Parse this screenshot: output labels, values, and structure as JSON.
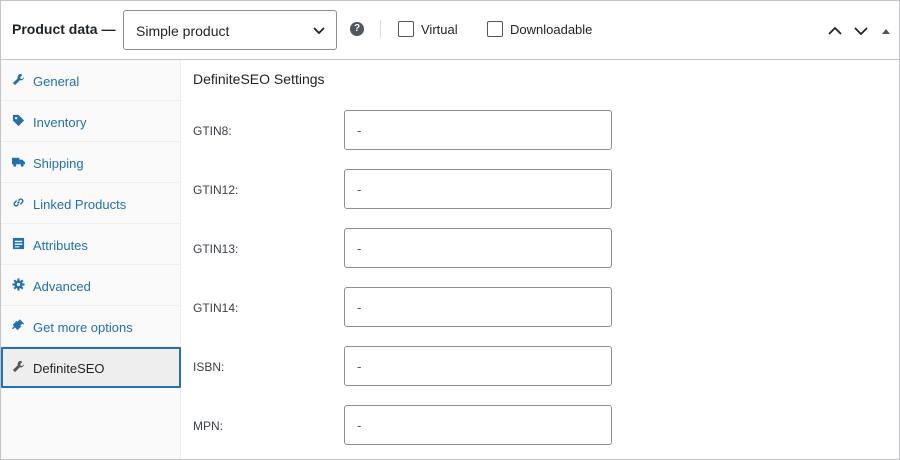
{
  "header": {
    "title": "Product data —",
    "product_type": {
      "selected": "Simple product"
    },
    "virtual_label": "Virtual",
    "downloadable_label": "Downloadable",
    "help_glyph": "?"
  },
  "sidebar": {
    "items": [
      {
        "label": "General",
        "icon": "wrench-icon",
        "active": false
      },
      {
        "label": "Inventory",
        "icon": "tag-icon",
        "active": false
      },
      {
        "label": "Shipping",
        "icon": "truck-icon",
        "active": false
      },
      {
        "label": "Linked Products",
        "icon": "link-icon",
        "active": false
      },
      {
        "label": "Attributes",
        "icon": "list-icon",
        "active": false
      },
      {
        "label": "Advanced",
        "icon": "gear-icon",
        "active": false
      },
      {
        "label": "Get more options",
        "icon": "plug-icon",
        "active": false
      },
      {
        "label": "DefiniteSEO",
        "icon": "wrench-icon",
        "active": true
      }
    ]
  },
  "main": {
    "section_title": "DefiniteSEO Settings",
    "fields": [
      {
        "label": "GTIN8:",
        "value": "-"
      },
      {
        "label": "GTIN12:",
        "value": "-"
      },
      {
        "label": "GTIN13:",
        "value": "-"
      },
      {
        "label": "GTIN14:",
        "value": "-"
      },
      {
        "label": "ISBN:",
        "value": "-"
      },
      {
        "label": "MPN:",
        "value": "-"
      }
    ]
  },
  "colors": {
    "link": "#2271b1",
    "active_border": "#2271b1",
    "border": "#c3c4c7",
    "icon": "#2271b1"
  }
}
